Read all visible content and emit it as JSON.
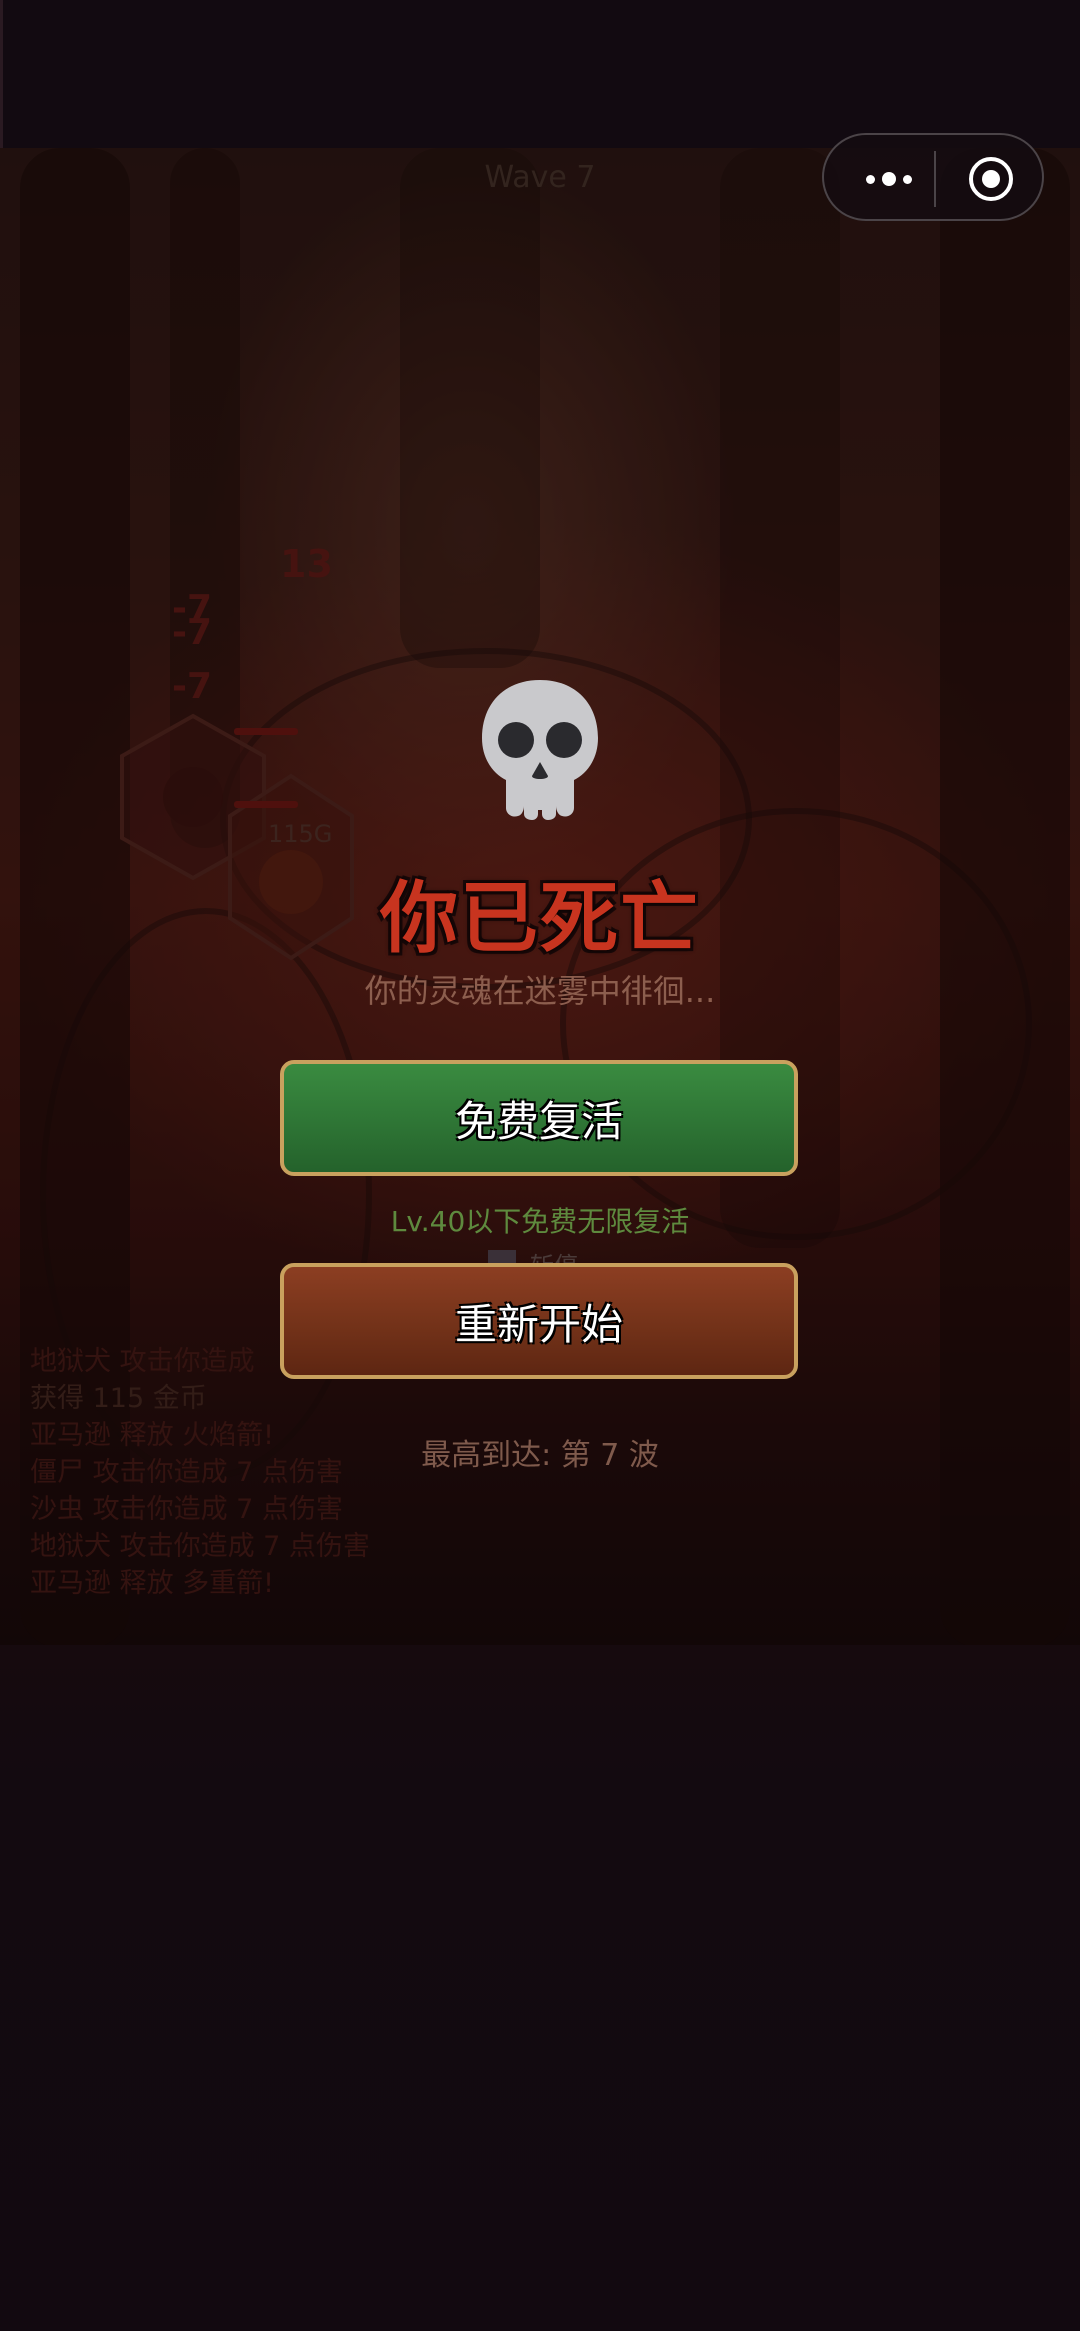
{
  "hud": {
    "wave_label": "Wave 7"
  },
  "mini_program_capsule": {
    "more_icon": "more-dots-icon",
    "close_icon": "target-circle-icon"
  },
  "battlefield": {
    "damage_numbers": [
      "13",
      "-7",
      "-7",
      "-7"
    ],
    "gold_drop": "115G"
  },
  "combat_log": [
    "地狱犬 攻击你造成",
    "获得 115 金币",
    "亚马逊 释放 火焰箭!",
    "僵尸 攻击你造成 7 点伤害",
    "沙虫 攻击你造成 7 点伤害",
    "地狱犬 攻击你造成 7 点伤害",
    "亚马逊 释放 多重箭!"
  ],
  "hidden_tab_label": "斩停",
  "death_dialog": {
    "icon": "skull-icon",
    "title": "你已死亡",
    "subtitle": "你的灵魂在迷雾中徘徊...",
    "revive_button": "免费复活",
    "revive_hint": "Lv.40以下免费无限复活",
    "restart_button": "重新开始",
    "best_wave": "最高到达: 第 7 波"
  },
  "colors": {
    "title_red": "#c8341f",
    "revive_green": "#2e7535",
    "restart_brown": "#733219",
    "button_border_gold": "#c9a15e"
  }
}
